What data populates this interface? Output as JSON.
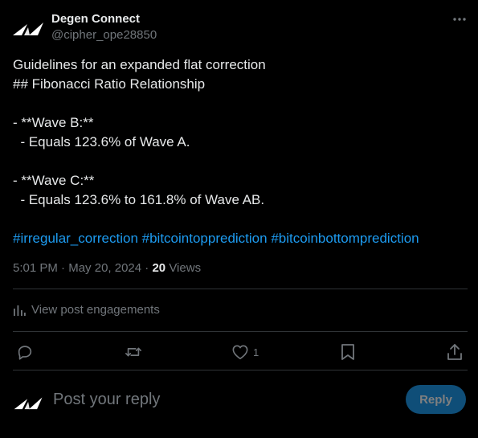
{
  "author": {
    "name": "Degen Connect",
    "handle": "@cipher_ope28850",
    "logo_icon": "degen-logo-icon"
  },
  "post": {
    "lines": [
      "Guidelines for an expanded flat correction",
      "## Fibonacci Ratio Relationship",
      "",
      "- **Wave B:**",
      "  - Equals 123.6% of Wave A.",
      "",
      "- **Wave C:**",
      "  - Equals 123.6% to 161.8% of Wave AB."
    ],
    "hashtags": [
      "#irregular_correction",
      "#bitcointopprediction",
      "#bitcoinbottomprediction"
    ]
  },
  "meta": {
    "time": "5:01 PM",
    "separator": "·",
    "date": "May 20, 2024",
    "views_count": "20",
    "views_label": "Views"
  },
  "engagements": {
    "label": "View post engagements",
    "icon": "bar-chart-icon"
  },
  "actions": {
    "reply_icon": "comment-icon",
    "retweet_icon": "retweet-icon",
    "like_icon": "heart-icon",
    "like_count": "1",
    "bookmark_icon": "bookmark-icon",
    "share_icon": "share-icon"
  },
  "composer": {
    "placeholder": "Post your reply",
    "button_label": "Reply"
  },
  "colors": {
    "background": "#000000",
    "text": "#e7e9ea",
    "secondary": "#71767b",
    "link": "#1d9bf0",
    "divider": "#2f3336",
    "reply_button_bg": "#0f4e78"
  }
}
